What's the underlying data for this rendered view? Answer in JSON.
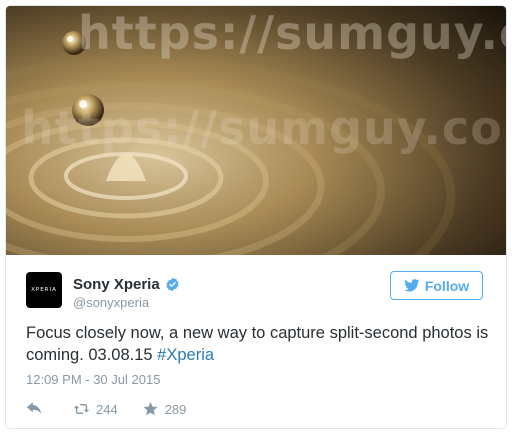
{
  "watermark": {
    "text": "https://sumguy.com"
  },
  "tweet": {
    "avatar_text": "XPERIA",
    "name": "Sony Xperia",
    "handle": "@sonyxperia",
    "follow_label": "Follow",
    "text": "Focus closely now, a new way to capture split-second photos is coming. 03.08.15 ",
    "hashtag": "#Xperia",
    "timestamp": "12:09 PM - 30 Jul 2015",
    "retweets": "244",
    "favorites": "289"
  },
  "icons": {
    "verified": "verified-badge-icon",
    "follow": "twitter-bird-icon",
    "reply": "reply-arrow-icon",
    "retweet": "retweet-icon",
    "favorite": "star-icon"
  },
  "colors": {
    "twitter_blue": "#55acee",
    "hashtag": "#2b7bb9",
    "muted": "#8899a6",
    "text": "#292f33"
  }
}
